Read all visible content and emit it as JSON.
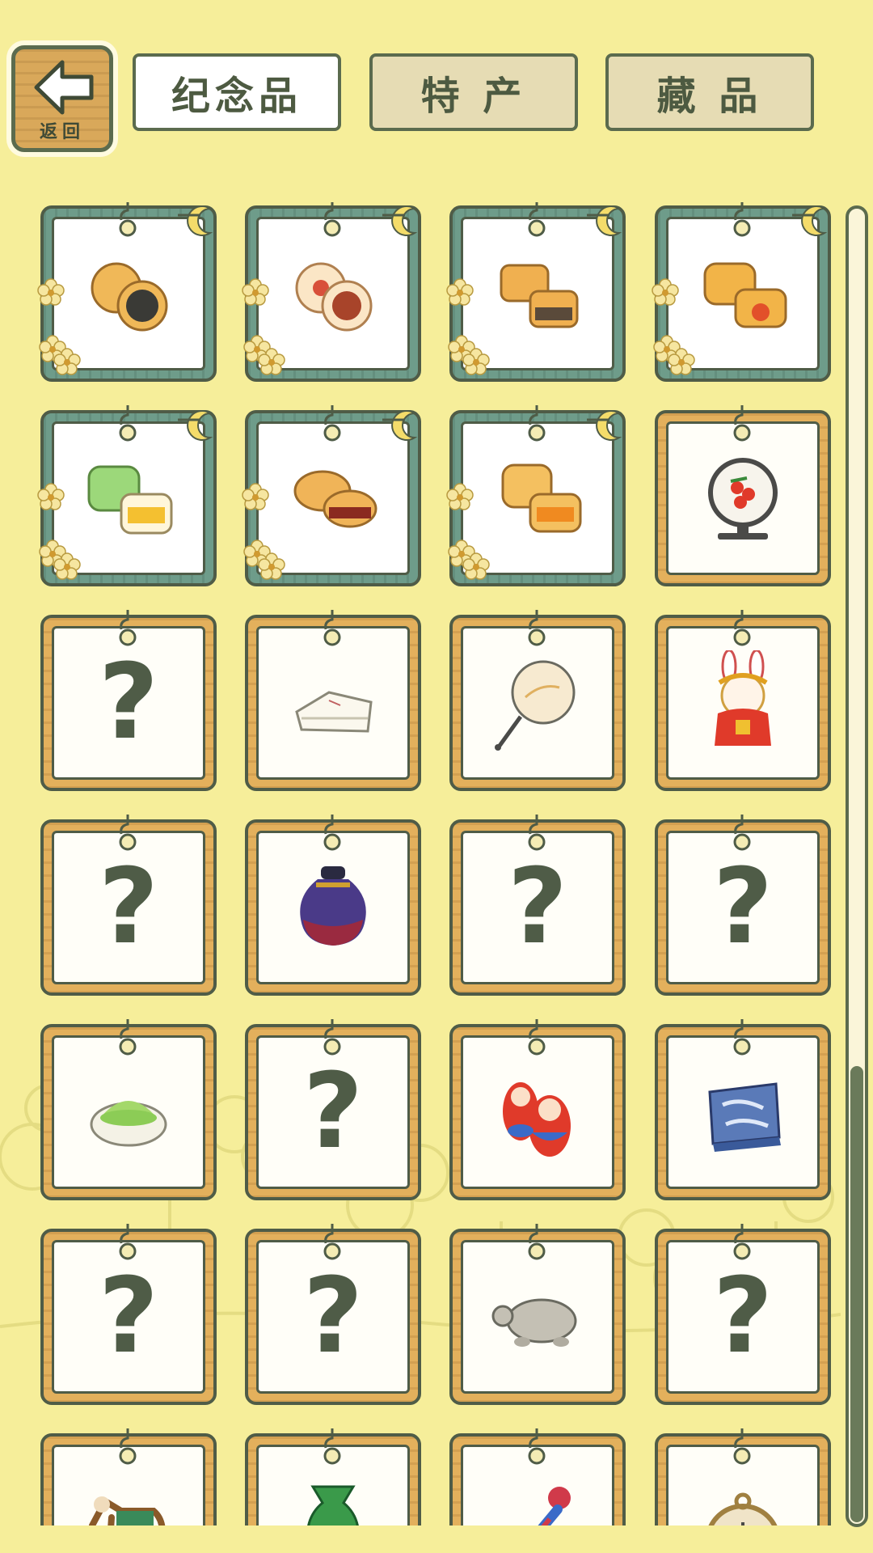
{
  "header": {
    "back_label": "返回",
    "tabs": [
      {
        "label": "纪念品",
        "active": true
      },
      {
        "label": "特 产",
        "active": false
      },
      {
        "label": "藏 品",
        "active": false
      }
    ]
  },
  "grid": {
    "items": [
      {
        "style": "teal",
        "icon": "mooncake-black-sesame-icon"
      },
      {
        "style": "teal",
        "icon": "mooncake-red-stamp-icon"
      },
      {
        "style": "teal",
        "icon": "mooncake-square-icon"
      },
      {
        "style": "teal",
        "icon": "mooncake-yolk-icon"
      },
      {
        "style": "teal",
        "icon": "mooncake-green-icon"
      },
      {
        "style": "teal",
        "icon": "mooncake-red-bean-icon"
      },
      {
        "style": "teal",
        "icon": "mooncake-lotus-icon"
      },
      {
        "style": "gold",
        "icon": "lychee-screen-icon"
      },
      {
        "style": "gold",
        "icon": "unknown-icon",
        "unknown": true
      },
      {
        "style": "gold",
        "icon": "folded-cloth-icon"
      },
      {
        "style": "gold",
        "icon": "round-fan-icon"
      },
      {
        "style": "gold",
        "icon": "rabbit-doll-icon"
      },
      {
        "style": "gold",
        "icon": "unknown-icon",
        "unknown": true
      },
      {
        "style": "gold",
        "icon": "porcelain-jar-icon"
      },
      {
        "style": "gold",
        "icon": "unknown-icon",
        "unknown": true
      },
      {
        "style": "gold",
        "icon": "unknown-icon",
        "unknown": true
      },
      {
        "style": "gold",
        "icon": "matcha-powder-icon"
      },
      {
        "style": "gold",
        "icon": "unknown-icon",
        "unknown": true
      },
      {
        "style": "gold",
        "icon": "nesting-dolls-icon"
      },
      {
        "style": "gold",
        "icon": "batik-cloth-icon"
      },
      {
        "style": "gold",
        "icon": "unknown-icon",
        "unknown": true
      },
      {
        "style": "gold",
        "icon": "unknown-icon",
        "unknown": true
      },
      {
        "style": "gold",
        "icon": "stone-turtle-icon"
      },
      {
        "style": "gold",
        "icon": "unknown-icon",
        "unknown": true
      },
      {
        "style": "gold",
        "icon": "tang-horse-icon"
      },
      {
        "style": "gold",
        "icon": "green-vase-icon"
      },
      {
        "style": "gold",
        "icon": "tassel-knot-icon"
      },
      {
        "style": "gold",
        "icon": "pocket-watch-icon"
      }
    ],
    "unknown_mark": "?"
  },
  "colors": {
    "background": "#f6ee9a",
    "frame_gold": "#e3b05c",
    "frame_teal": "#6e9c8a",
    "outline": "#4f5c47"
  },
  "scroll": {
    "position": "bottom"
  }
}
